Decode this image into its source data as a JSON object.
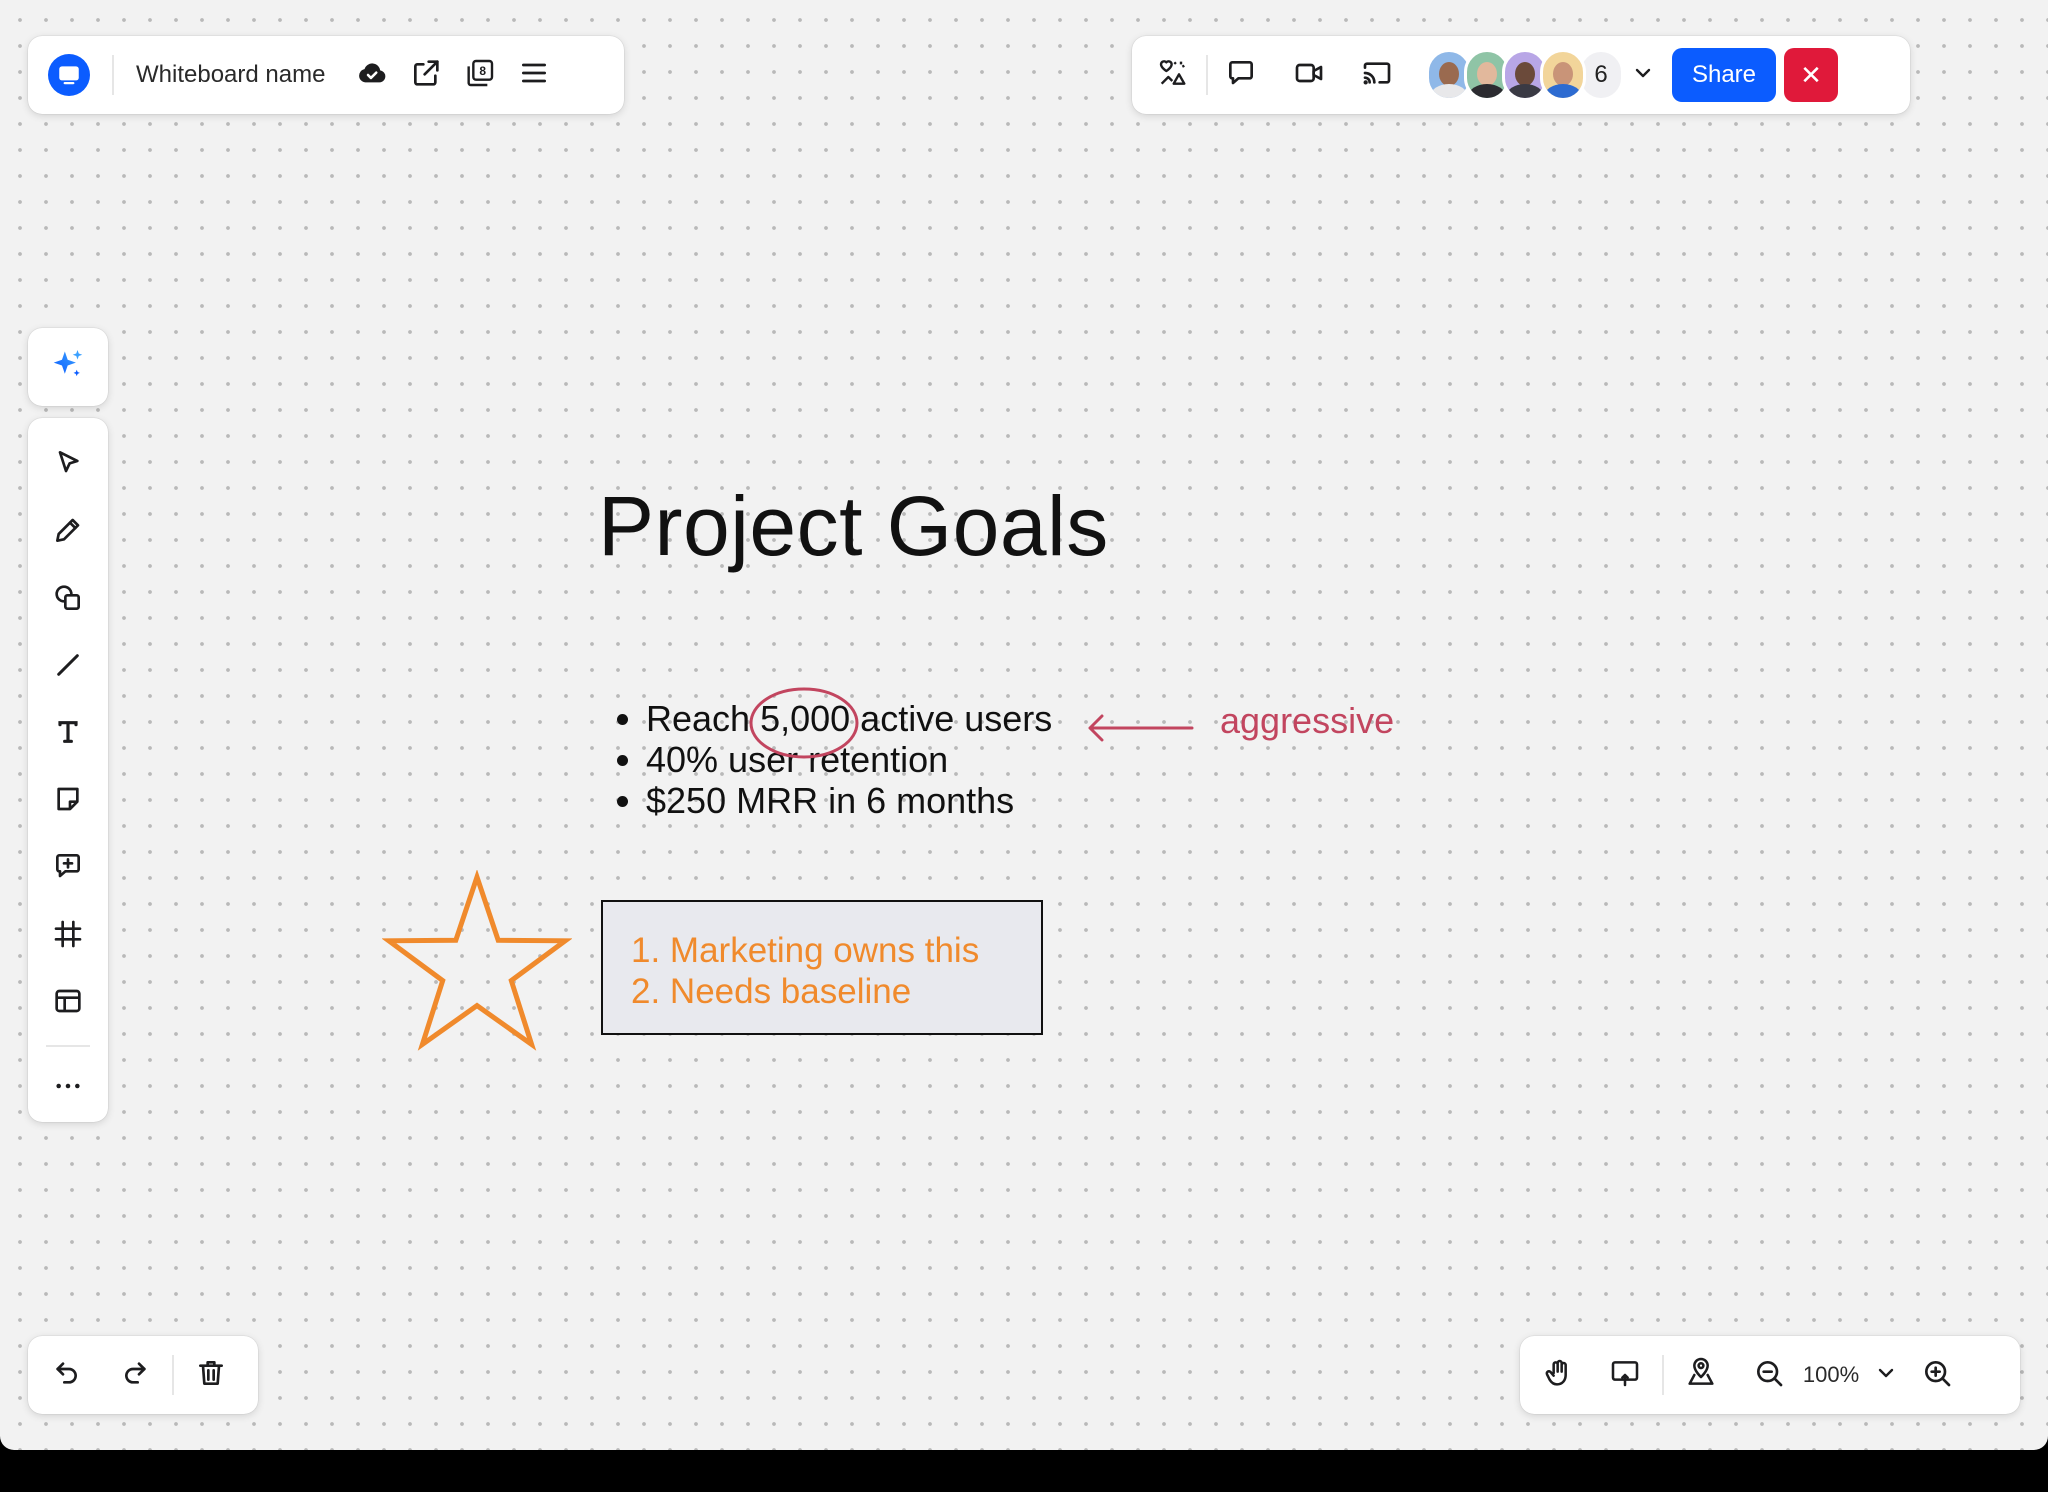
{
  "header": {
    "whiteboard_name": "Whiteboard name",
    "pages_count": "8"
  },
  "collaboration": {
    "participant_count": "6",
    "share_label": "Share",
    "close_label": "✕"
  },
  "board": {
    "title": "Project Goals",
    "goals": [
      {
        "before": "Reach ",
        "highlight": "5,000",
        "after": " active users"
      },
      {
        "text": "40% user retention"
      },
      {
        "text": "$250 MRR in 6 months"
      }
    ],
    "annotation": "aggressive",
    "notes": [
      "1. Marketing owns this",
      "2. Needs baseline"
    ]
  },
  "zoom": {
    "level": "100%"
  },
  "colors": {
    "brand": "#0b5cff",
    "close": "#e0193a",
    "annotation": "#c2455f",
    "star": "#f08a2c",
    "note_bg": "#e8e9ee"
  },
  "icons": {
    "top_left": [
      "app-logo-icon",
      "cloud-check-icon",
      "share-out-icon",
      "pages-icon",
      "menu-icon"
    ],
    "top_right": [
      "reactions-icon",
      "chat-icon",
      "video-icon",
      "cast-icon",
      "chevron-down-icon"
    ],
    "tools": [
      "ai-sparkle-icon",
      "select-pointer-icon",
      "pen-icon",
      "shapes-icon",
      "line-icon",
      "text-icon",
      "sticky-note-icon",
      "comment-icon",
      "frame-icon",
      "template-icon",
      "more-icon"
    ],
    "bottom": [
      "undo-icon",
      "redo-icon",
      "trash-icon",
      "hand-icon",
      "present-icon",
      "map-pin-icon",
      "zoom-out-icon",
      "chevron-down-icon",
      "zoom-in-icon"
    ]
  }
}
